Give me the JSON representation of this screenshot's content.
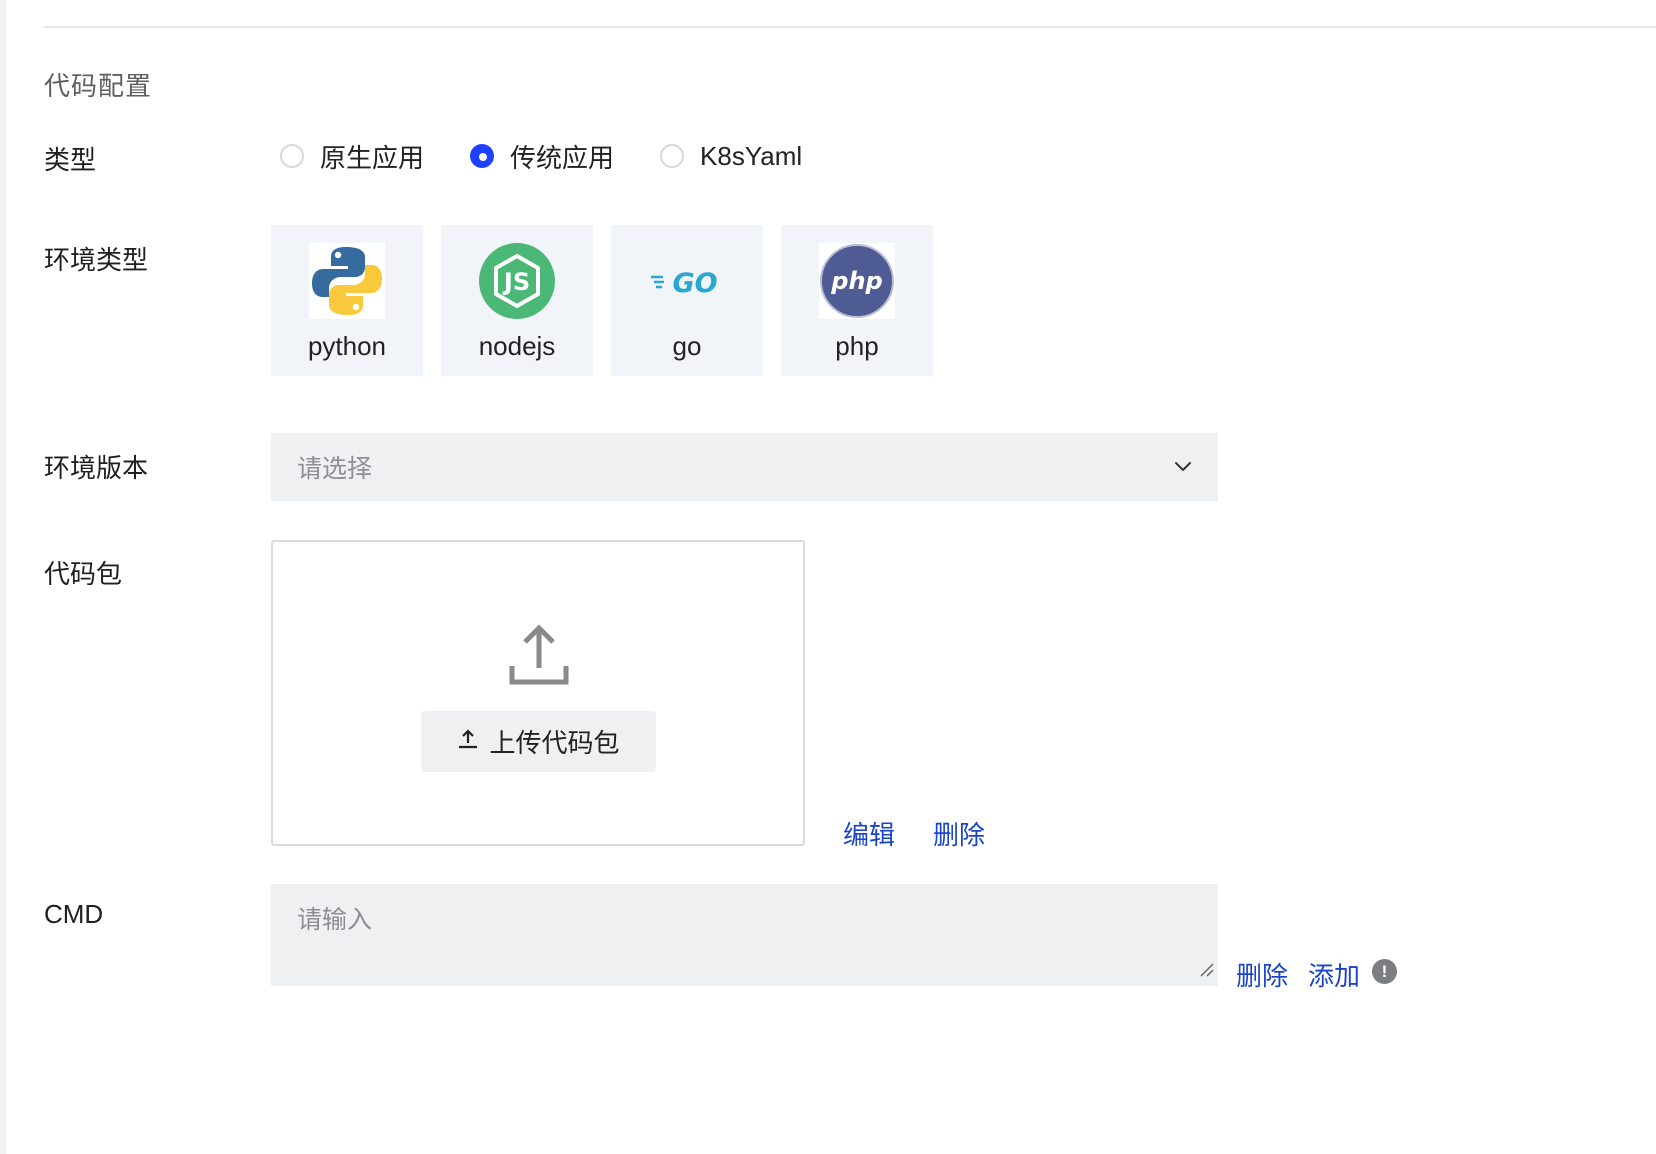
{
  "section": {
    "title": "代码配置"
  },
  "type_row": {
    "label": "类型",
    "options": [
      {
        "label": "原生应用",
        "checked": false
      },
      {
        "label": "传统应用",
        "checked": true
      },
      {
        "label": "K8sYaml",
        "checked": false
      }
    ]
  },
  "env_type_row": {
    "label": "环境类型",
    "options": [
      {
        "name": "python",
        "icon": "python-logo"
      },
      {
        "name": "nodejs",
        "icon": "nodejs-logo"
      },
      {
        "name": "go",
        "icon": "go-logo"
      },
      {
        "name": "php",
        "icon": "php-logo"
      }
    ]
  },
  "env_version_row": {
    "label": "环境版本",
    "placeholder": "请选择"
  },
  "code_package_row": {
    "label": "代码包",
    "upload_button_label": "上传代码包",
    "edit_label": "编辑",
    "delete_label": "删除"
  },
  "cmd_row": {
    "label": "CMD",
    "placeholder": "请输入",
    "delete_label": "删除",
    "add_label": "添加",
    "info_glyph": "!"
  },
  "colors": {
    "accent": "#1e40ff",
    "link": "#1a45c9",
    "input_bg": "#eff0f2",
    "card_bg": "#f1f4f8"
  }
}
